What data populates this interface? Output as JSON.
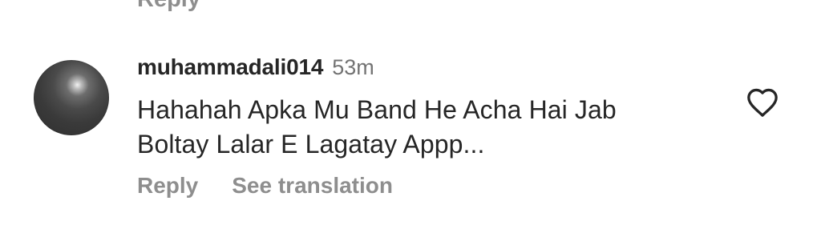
{
  "previous_comment": {
    "reply_label": "Reply"
  },
  "comment": {
    "username": "muhammadali014",
    "time": "53m",
    "text_line1": "Hahahah Apka Mu Band He Acha Hai Jab",
    "text_line2": "Boltay Lalar E Lagatay Appp...",
    "reply_label": "Reply",
    "translate_label": "See translation",
    "like_icon": "heart-outline-icon"
  },
  "colors": {
    "text_primary": "#262626",
    "text_secondary": "#8e8e8e",
    "timestamp": "#737373"
  }
}
